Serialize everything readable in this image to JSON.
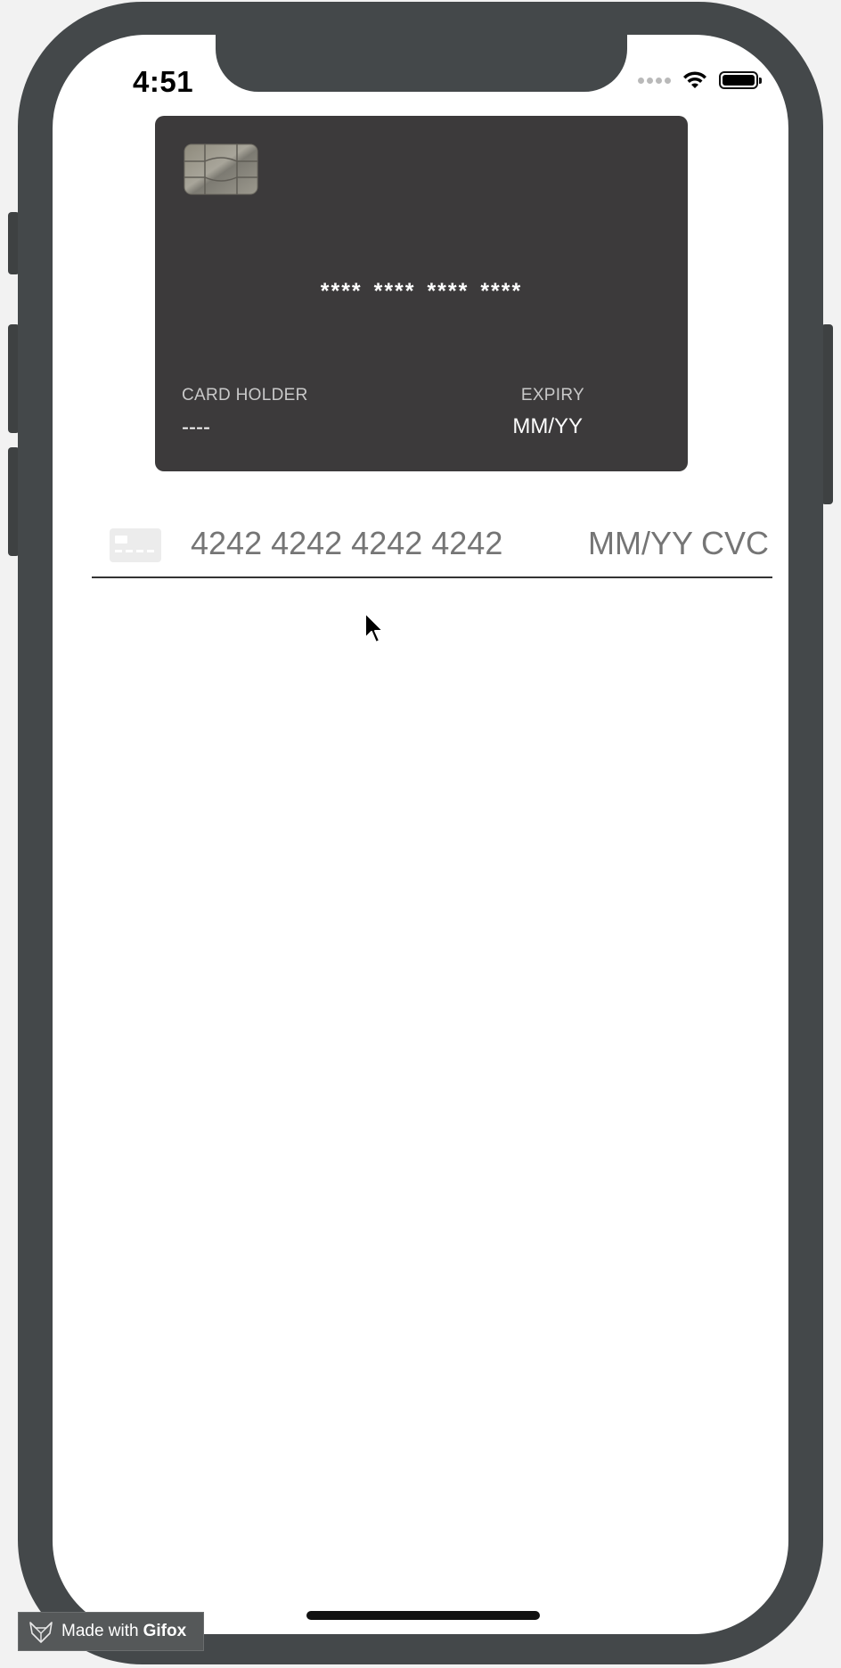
{
  "status_bar": {
    "time": "4:51",
    "icons": [
      "cellular-signal-icon",
      "wifi-icon",
      "battery-icon"
    ]
  },
  "card_preview": {
    "number": "**** **** **** ****",
    "holder_label": "CARD HOLDER",
    "holder_value": "----",
    "expiry_label": "EXPIRY",
    "expiry_value": "MM/YY",
    "background_color": "#3c3a3b"
  },
  "card_input": {
    "number_placeholder": "4242 4242 4242 4242",
    "expiry_placeholder": "MM/YY",
    "cvc_placeholder": "CVC",
    "brand_icon": "generic-card-icon"
  },
  "watermark": {
    "prefix": "Made with",
    "brand": "Gifox"
  },
  "colors": {
    "device_frame": "#44484a",
    "placeholder_text": "#b7b7b7",
    "underline": "#333333"
  }
}
